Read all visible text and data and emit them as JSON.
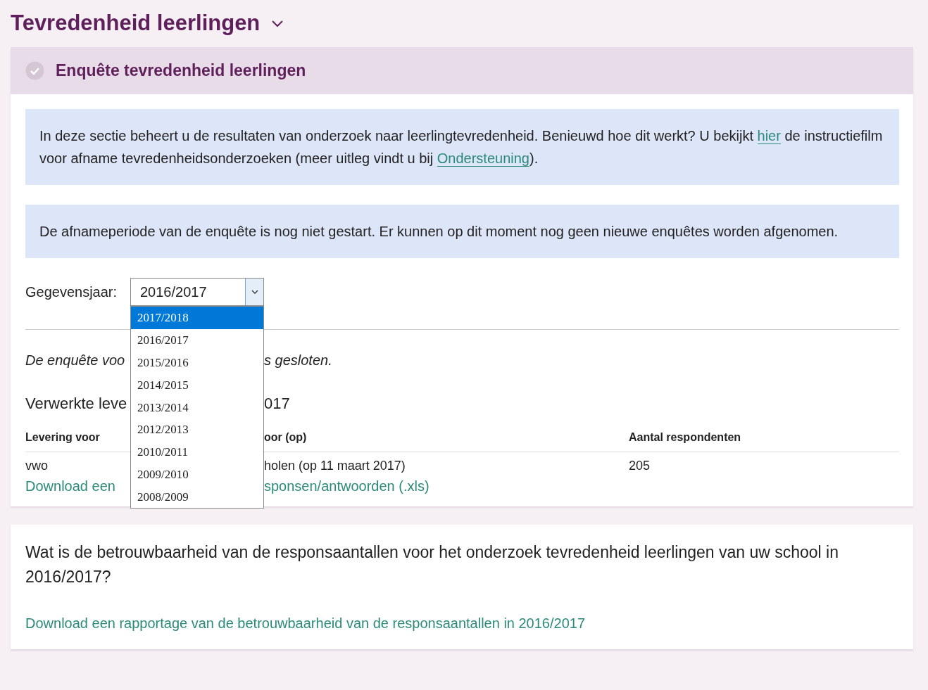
{
  "page_title": "Tevredenheid leerlingen",
  "panel": {
    "title": "Enquête tevredenheid leerlingen",
    "notices": [
      {
        "parts": [
          {
            "kind": "text",
            "text": "In deze sectie beheert u de resultaten van onderzoek naar leerlingtevredenheid. Benieuwd hoe dit werkt? U bekijkt "
          },
          {
            "kind": "link",
            "text": "hier"
          },
          {
            "kind": "text",
            "text": " de instructiefilm voor afname tevredenheidsonderzoeken (meer uitleg vindt u bij "
          },
          {
            "kind": "link",
            "text": "Ondersteuning"
          },
          {
            "kind": "text",
            "text": ")."
          }
        ]
      },
      {
        "parts": [
          {
            "kind": "text",
            "text": "De afnameperiode van de enquête is nog niet gestart. Er kunnen op dit moment nog geen nieuwe enquêtes worden afgenomen."
          }
        ]
      }
    ],
    "year_select": {
      "label": "Gegevensjaar:",
      "value": "2016/2017",
      "expanded": true,
      "options": [
        {
          "label": "2017/2018",
          "highlighted": true
        },
        {
          "label": "2016/2017",
          "highlighted": false
        },
        {
          "label": "2015/2016",
          "highlighted": false
        },
        {
          "label": "2014/2015",
          "highlighted": false
        },
        {
          "label": "2013/2014",
          "highlighted": false
        },
        {
          "label": "2012/2013",
          "highlighted": false
        },
        {
          "label": "2010/2011",
          "highlighted": false
        },
        {
          "label": "2009/2010",
          "highlighted": false
        },
        {
          "label": "2008/2009",
          "highlighted": false
        }
      ]
    },
    "status_text": [
      "De enquête voo",
      "s gesloten."
    ],
    "deliveries_heading": [
      "Verwerkte leve",
      "017"
    ],
    "columns": [
      [
        "Levering voor",
        "oor (op)"
      ],
      [
        "Aantal respondenten"
      ]
    ],
    "rows": [
      {
        "cells": [
          [
            "vwo",
            "holen (op 11 maart 2017)"
          ],
          [
            "205"
          ]
        ]
      }
    ],
    "download_link": [
      "Download een",
      "sponsen/antwoorden (.xls)"
    ]
  },
  "reliability": {
    "question": "Wat is de betrouwbaarheid van de responsaantallen voor het onderzoek tevredenheid leerlingen van uw school in 2016/2017?",
    "link": "Download een rapportage van de betrouwbaarheid van de responsaantallen in 2016/2017"
  }
}
